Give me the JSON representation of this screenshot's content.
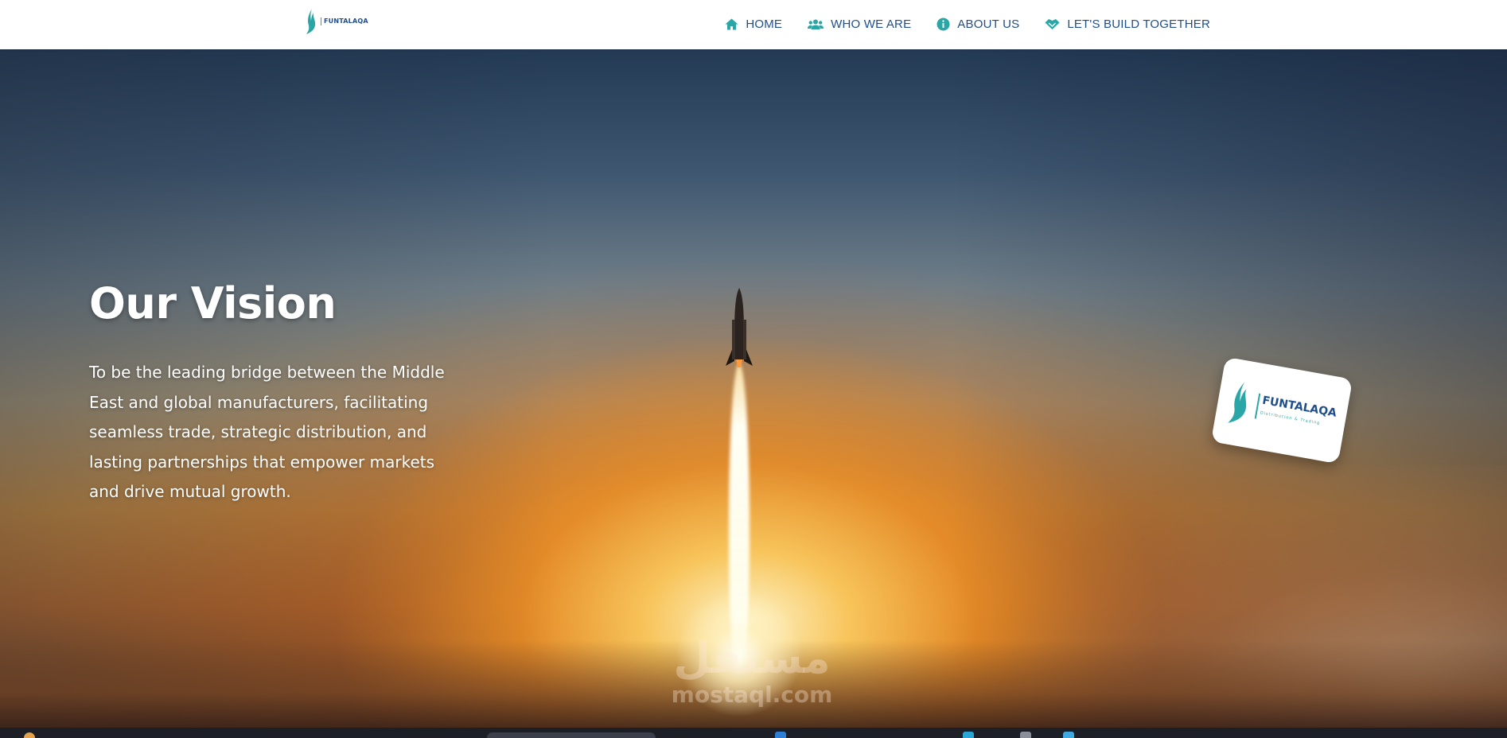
{
  "header": {
    "logo": {
      "text": "FUNTALAQA"
    },
    "nav": [
      {
        "label": "HOME",
        "icon": "home-icon"
      },
      {
        "label": "WHO WE ARE",
        "icon": "users-icon"
      },
      {
        "label": "ABOUT US",
        "icon": "info-icon"
      },
      {
        "label": "LET'S BUILD TOGETHER",
        "icon": "handshake-icon"
      }
    ]
  },
  "hero": {
    "title": "Our Vision",
    "text": "To be the leading bridge between the Middle East and global manufacturers, facilitating seamless trade, strategic distribution, and lasting partnerships that empower markets and drive mutual growth.",
    "card": {
      "logo_text": "FUNTALAQA",
      "sub": "Distribution & Trading"
    },
    "watermark": {
      "arabic": "مستقل",
      "latin": "mostaql.com"
    }
  },
  "colors": {
    "nav_text": "#1f4e8c",
    "nav_icon": "#2aa6a6",
    "header_bg": "#ffffff"
  }
}
